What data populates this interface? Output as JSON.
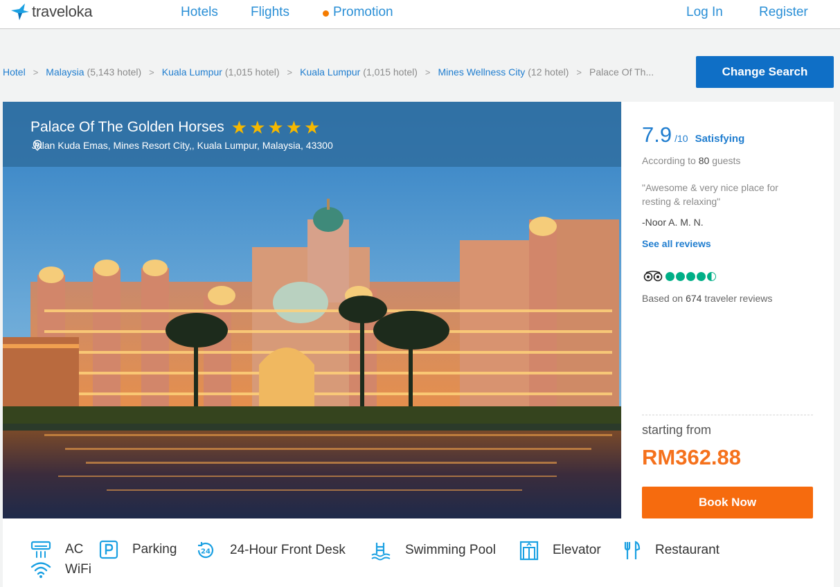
{
  "header": {
    "logo_text": "traveloka",
    "nav": {
      "hotels": "Hotels",
      "flights": "Flights",
      "promotion": "Promotion",
      "login": "Log In",
      "register": "Register"
    }
  },
  "breadcrumb": {
    "items": [
      {
        "label": "Hotel",
        "count": ""
      },
      {
        "label": "Malaysia",
        "count": "(5,143 hotel)"
      },
      {
        "label": "Kuala Lumpur",
        "count": "(1,015 hotel)"
      },
      {
        "label": "Kuala Lumpur",
        "count": "(1,015 hotel)"
      },
      {
        "label": "Mines Wellness City",
        "count": "(12 hotel)"
      }
    ],
    "separator": ">",
    "current": "Palace Of Th..."
  },
  "change_search_label": "Change Search",
  "hotel": {
    "name": "Palace Of The Golden Horses",
    "stars": 5,
    "star_glyph": "★",
    "address": "Jalan Kuda Emas, Mines Resort City,, Kuala Lumpur, Malaysia, 43300"
  },
  "rating": {
    "score": "7.9",
    "out_of": "/10",
    "word": "Satisfying",
    "according_prefix": "According to",
    "guest_count": "80",
    "according_suffix": "guests",
    "quote": "\"Awesome & very nice place for resting & relaxing\"",
    "reviewer": "-Noor A. M. N.",
    "see_all": "See all reviews"
  },
  "tripadvisor": {
    "bubbles": 4.5,
    "based_prefix": "Based on",
    "count": "674",
    "based_suffix": "traveler reviews"
  },
  "pricing": {
    "starting_label": "starting from",
    "price": "RM362.88",
    "book_label": "Book Now"
  },
  "facilities": [
    {
      "icon": "ac-icon",
      "label": "AC"
    },
    {
      "icon": "parking-icon",
      "label": "Parking"
    },
    {
      "icon": "24-hour-icon",
      "label": "24-Hour Front Desk"
    },
    {
      "icon": "swimming-pool-icon",
      "label": "Swimming Pool"
    },
    {
      "icon": "elevator-icon",
      "label": "Elevator"
    },
    {
      "icon": "restaurant-icon",
      "label": "Restaurant"
    },
    {
      "icon": "wifi-icon",
      "label": "WiFi"
    }
  ],
  "colors": {
    "brand_blue": "#1f7dcf",
    "button_blue": "#0f6fc6",
    "price_orange": "#f5711c",
    "book_orange": "#f66b0e",
    "star_yellow": "#f5b800",
    "tripadvisor_green": "#00af87"
  }
}
